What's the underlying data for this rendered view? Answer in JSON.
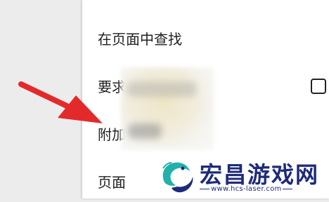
{
  "menu": {
    "items": [
      {
        "label": "在页面中查找"
      },
      {
        "label": "要求"
      },
      {
        "label": "附加"
      },
      {
        "label": "页面"
      }
    ],
    "checkbox_checked": false
  },
  "watermark": {
    "title": "宏昌游戏网",
    "url": "www.hcs-laser.com"
  },
  "colors": {
    "arrow": "#e32a2a",
    "watermark_blue": "#1e2b7a",
    "logo_teal": "#22b1a8"
  }
}
